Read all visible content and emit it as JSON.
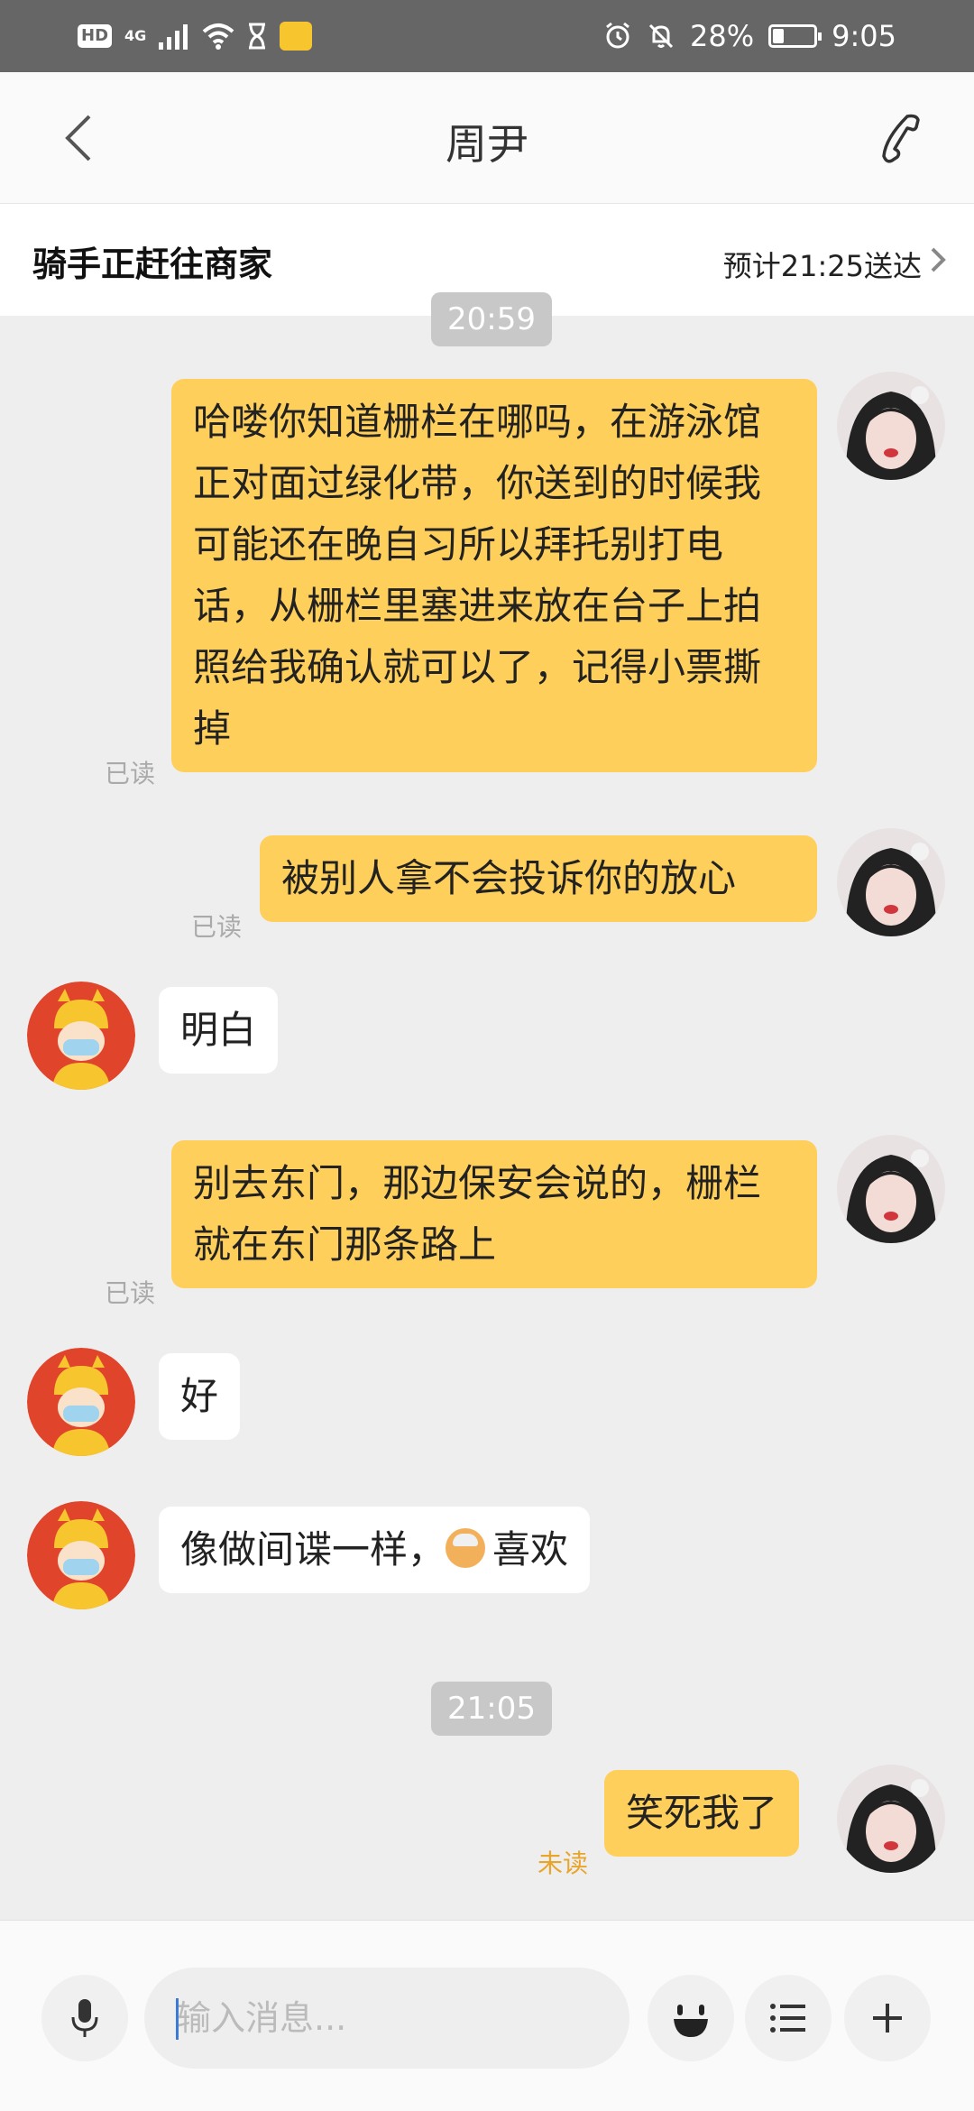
{
  "status_bar": {
    "hd": "HD",
    "network": "4G",
    "battery_percent": "28%",
    "battery_level": 0.28,
    "time": "9:05"
  },
  "header": {
    "title": "周尹"
  },
  "order": {
    "status": "骑手正赶往商家",
    "eta": "预计21:25送达"
  },
  "messages": [
    {
      "type": "time",
      "text": "20:59"
    },
    {
      "type": "sent",
      "text": "哈喽你知道栅栏在哪吗，在游泳馆正对面过绿化带，你送到的时候我可能还在晚自习所以拜托别打电话，从栅栏里塞进来放在台子上拍照给我确认就可以了，记得小票撕掉",
      "read": "已读"
    },
    {
      "type": "sent",
      "text": "被别人拿不会投诉你的放心",
      "read": "已读"
    },
    {
      "type": "received",
      "text": "明白"
    },
    {
      "type": "sent",
      "text": "别去东门，那边保安会说的，栅栏就在东门那条路上",
      "read": "已读"
    },
    {
      "type": "received",
      "text": "好"
    },
    {
      "type": "received",
      "text_before": "像做间谍一样，",
      "text_after": "喜欢"
    },
    {
      "type": "time",
      "text": "21:05"
    },
    {
      "type": "sent",
      "text": "笑死我了",
      "read": "未读"
    }
  ],
  "input": {
    "placeholder": "输入消息..."
  },
  "colors": {
    "sent_bubble": "#ffcf5c",
    "received_bubble": "#ffffff",
    "unread_label": "#e8a52a",
    "background": "#eeeeee"
  },
  "icons": {
    "back": "chevron-left-icon",
    "call": "phone-icon",
    "order_arrow": "chevron-right-icon",
    "voice": "microphone-icon",
    "emoji": "emoji-icon",
    "menu": "list-icon",
    "more": "plus-icon"
  }
}
